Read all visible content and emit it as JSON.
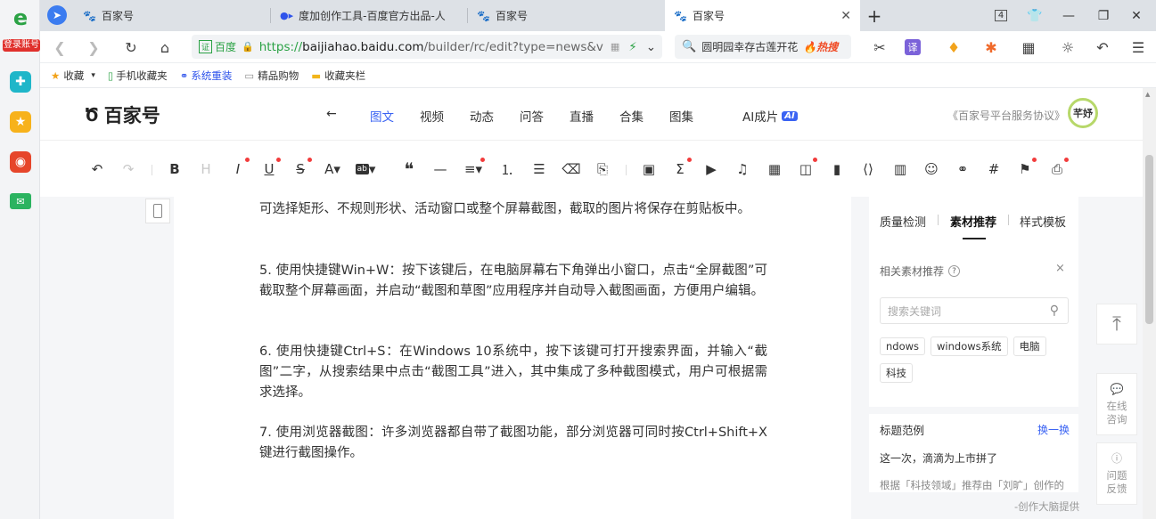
{
  "left_sidebar": {
    "login_label": "登录账号"
  },
  "tabs": [
    {
      "title": "百家号",
      "icon": "paw-icon"
    },
    {
      "title": "度加创作工具-百度官方出品-人",
      "icon": "ai-icon"
    },
    {
      "title": "百家号",
      "icon": "paw-icon"
    },
    {
      "title": "百家号",
      "icon": "paw-icon",
      "active": true
    }
  ],
  "window": {
    "tab_count": "4"
  },
  "address_bar": {
    "site_label": "百度",
    "url_prefix": "https://",
    "url_domain": "baijiahao.baidu.com",
    "url_path": "/builder/rc/edit?type=news&v"
  },
  "search_bar": {
    "query": "圆明园幸存古莲开花",
    "hot_label": "热搜"
  },
  "bookmarks": [
    {
      "label": "收藏",
      "icon": "star-icon"
    },
    {
      "label": "手机收藏夹",
      "icon": "phone-icon"
    },
    {
      "label": "系统重装",
      "icon": "link-icon"
    },
    {
      "label": "精品购物",
      "icon": "page-icon"
    },
    {
      "label": "收藏夹栏",
      "icon": "folder-icon"
    }
  ],
  "header": {
    "brand": "百家号",
    "nav": [
      "图文",
      "视频",
      "动态",
      "问答",
      "直播",
      "合集",
      "图集",
      "AI成片"
    ],
    "ai_badge": "AI",
    "agreement": "《百家号平台服务协议》",
    "avatar_text": "芊妤",
    "accent": "#3a63f3"
  },
  "editor": {
    "paragraphs": [
      "可选择矩形、不规则形状、活动窗口或整个屏幕截图，截取的图片将保存在剪贴板中。",
      "5. 使用快捷键Win+W：按下该键后，在电脑屏幕右下角弹出小窗口，点击“全屏截图”可截取整个屏幕画面，并启动“截图和草图”应用程序并自动导入截图画面，方便用户编辑。",
      "6. 使用快捷键Ctrl+S：在Windows 10系统中，按下该键可打开搜索界面，并输入“截图”二字，从搜索结果中点击“截图工具”进入，其中集成了多种截图模式，用户可根据需求选择。",
      "7. 使用浏览器截图：许多浏览器都自带了截图功能，部分浏览器可同时按Ctrl+Shift+X键进行截图操作。"
    ]
  },
  "side_panel": {
    "tabs": [
      "质量检测",
      "素材推荐",
      "样式模板"
    ],
    "active_tab": "素材推荐",
    "materials_title": "相关素材推荐",
    "search_placeholder": "搜索关键词",
    "tags": [
      "ndows",
      "windows系统",
      "电脑",
      "科技"
    ],
    "titles_heading": "标题范例",
    "refresh_label": "换一换",
    "example_title": "这一次，滴滴为上市拼了",
    "recommend_note": "根据「科技领域」推荐由「刘旷」创作的标题",
    "footer_note": "-创作大脑提供"
  },
  "float_buttons": {
    "consult": "在线咨询",
    "feedback": "问题反馈"
  }
}
